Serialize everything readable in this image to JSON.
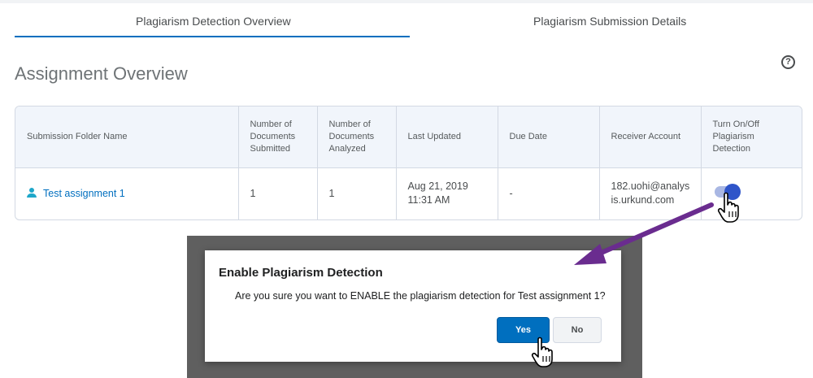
{
  "tabs": [
    {
      "label": "Plagiarism Detection Overview",
      "active": true
    },
    {
      "label": "Plagiarism Submission Details",
      "active": false
    }
  ],
  "heading": "Assignment Overview",
  "help_icon": "question-circle-icon",
  "table": {
    "headers": {
      "folder": "Submission Folder Name",
      "submitted_1": "Number of",
      "submitted_2": "Documents",
      "submitted_3": "Submitted",
      "analyzed_1": "Number of",
      "analyzed_2": "Documents",
      "analyzed_3": "Analyzed",
      "updated": "Last Updated",
      "due": "Due Date",
      "receiver": "Receiver Account",
      "toggle_1": "Turn On/Off",
      "toggle_2": "Plagiarism",
      "toggle_3": "Detection"
    },
    "rows": [
      {
        "folder": "Test assignment 1",
        "submitted": "1",
        "analyzed": "1",
        "updated_1": "Aug 21, 2019",
        "updated_2": "11:31 AM",
        "due": "-",
        "receiver_1": "182.uohi@analys",
        "receiver_2": "is.urkund.com",
        "detection_enabled": true
      }
    ]
  },
  "dialog": {
    "title": "Enable Plagiarism Detection",
    "body": "Are you sure you want to ENABLE the plagiarism detection for Test assignment 1?",
    "yes": "Yes",
    "no": "No"
  },
  "colors": {
    "accent": "#006fbf",
    "toggle": "#2f55c9",
    "annotation_arrow": "#6a2c8f"
  }
}
